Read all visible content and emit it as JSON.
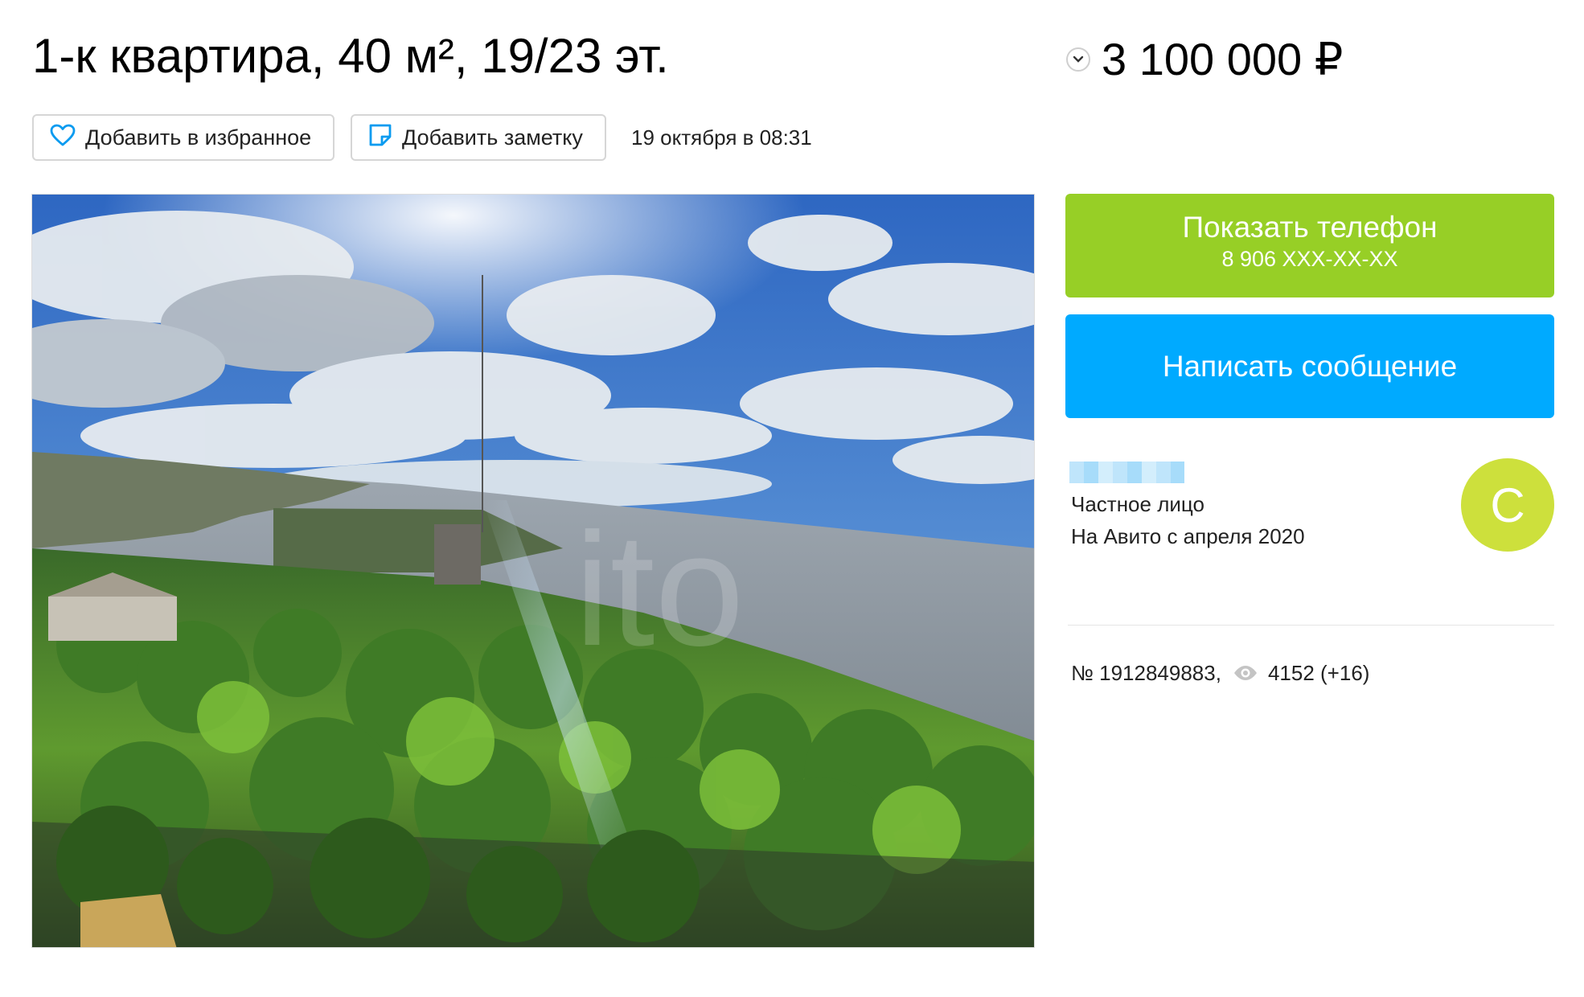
{
  "listing": {
    "title": "1-к квартира, 40 м², 19/23 эт.",
    "price": "3 100 000 ₽",
    "date": "19 октября в 08:31",
    "number": "№ 1912849883,",
    "views": "4152 (+16)"
  },
  "actions": {
    "favorite_label": "Добавить в избранное",
    "note_label": "Добавить заметку"
  },
  "contact": {
    "show_phone_label": "Показать телефон",
    "phone_masked": "8 906 XXX-XX-XX",
    "message_label": "Написать сообщение"
  },
  "seller": {
    "type": "Частное лицо",
    "since": "На Авито с апреля 2020",
    "avatar_letter": "С"
  },
  "icons": {
    "price_toggle": "chevron-down-icon",
    "favorite": "heart-icon",
    "note": "note-icon",
    "views": "eye-icon"
  },
  "colors": {
    "phone_button": "#97cf26",
    "message_button": "#00aaff",
    "avatar": "#cde03c",
    "icon_accent": "#0a9bf0"
  }
}
